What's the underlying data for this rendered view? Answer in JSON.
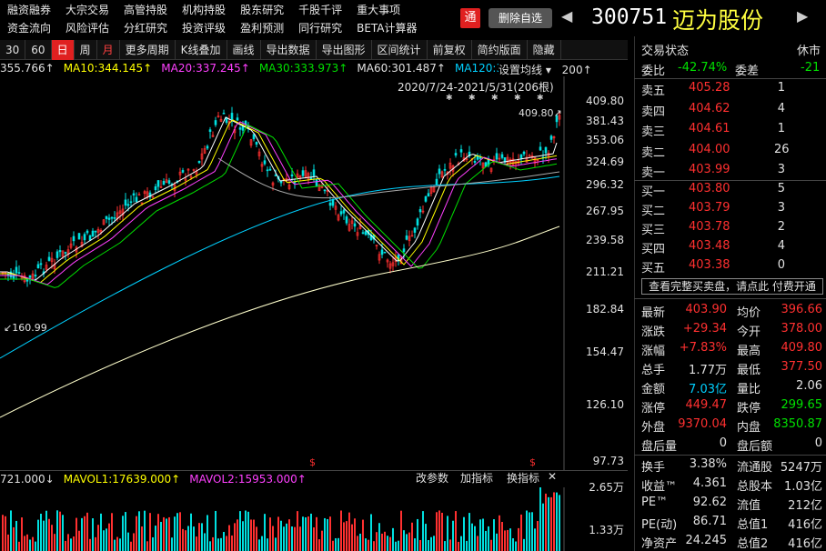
{
  "nav1": [
    "融资融券",
    "大宗交易",
    "高管持股",
    "机构持股",
    "股东研究",
    "千股千评",
    "重大事项"
  ],
  "nav2": [
    "资金流向",
    "风险评估",
    "分红研究",
    "投资评级",
    "盈利预测",
    "同行研究",
    "BETA计算器"
  ],
  "header": {
    "tong": "通",
    "remove": "删除自选",
    "left_arrow": "◀",
    "right_arrow": "▶",
    "code": "300751",
    "name": "迈为股份"
  },
  "toolbar": [
    "30",
    "60",
    "日",
    "周",
    "月",
    "更多周期",
    "K线叠加",
    "画线",
    "导出数据",
    "导出图形",
    "区间统计",
    "前复权",
    "简约版面",
    "隐藏"
  ],
  "ma": [
    {
      "label": "355.766↑",
      "color": "#e0e0e0"
    },
    {
      "label": "MA10:344.145↑",
      "color": "#ffff00"
    },
    {
      "label": "MA20:337.245↑",
      "color": "#ff40ff"
    },
    {
      "label": "MA30:333.973↑",
      "color": "#00e000"
    },
    {
      "label": "MA60:301.487↑",
      "color": "#e0e0e0"
    },
    {
      "label": "MA120:305.770",
      "color": "#00d0ff"
    }
  ],
  "ma_set": "设置均线",
  "ma_tail": "200↑",
  "daterange": "2020/7/24-2021/5/31(206根)",
  "yaxis": [
    "409.80",
    "381.43",
    "353.06",
    "324.69",
    "296.32",
    "267.95",
    "239.58",
    "211.21",
    "182.84",
    "154.47",
    "126.10",
    "97.73"
  ],
  "annot_high": "409.80↗",
  "annot_low": "↙160.99",
  "vol": {
    "head": [
      {
        "label": "721.000↓",
        "color": "#e0e0e0"
      },
      {
        "label": "MAVOL1:17639.000↑",
        "color": "#ffff00"
      },
      {
        "label": "MAVOL2:15953.000↑",
        "color": "#ff40ff"
      }
    ],
    "btns": [
      "改参数",
      "加指标",
      "换指标",
      "✕"
    ],
    "yaxis": [
      "2.65万",
      "1.33万"
    ]
  },
  "panel": {
    "title": "交易状态",
    "status": "休市",
    "weibi_label": "委比",
    "weibi": "-42.74%",
    "weicha_label": "委差",
    "weicha": "-21",
    "sells": [
      {
        "k": "卖五",
        "p": "405.28",
        "v": "1"
      },
      {
        "k": "卖四",
        "p": "404.62",
        "v": "4"
      },
      {
        "k": "卖三",
        "p": "404.61",
        "v": "1"
      },
      {
        "k": "卖二",
        "p": "404.00",
        "v": "26"
      },
      {
        "k": "卖一",
        "p": "403.99",
        "v": "3"
      }
    ],
    "buys": [
      {
        "k": "买一",
        "p": "403.80",
        "v": "5"
      },
      {
        "k": "买二",
        "p": "403.79",
        "v": "3"
      },
      {
        "k": "买三",
        "p": "403.78",
        "v": "2"
      },
      {
        "k": "买四",
        "p": "403.48",
        "v": "4"
      },
      {
        "k": "买五",
        "p": "403.38",
        "v": "0"
      }
    ],
    "banner": "查看完整买卖盘，请点此 付费开通",
    "stats": [
      {
        "k": "最新",
        "v": "403.90",
        "c": "red",
        "k2": "均价",
        "v2": "396.66",
        "c2": "red"
      },
      {
        "k": "涨跌",
        "v": "+29.34",
        "c": "red",
        "k2": "今开",
        "v2": "378.00",
        "c2": "red"
      },
      {
        "k": "涨幅",
        "v": "+7.83%",
        "c": "red",
        "k2": "最高",
        "v2": "409.80",
        "c2": "red"
      },
      {
        "k": "总手",
        "v": "1.77万",
        "c": "white",
        "k2": "最低",
        "v2": "377.50",
        "c2": "red"
      },
      {
        "k": "金额",
        "v": "7.03亿",
        "c": "cyan",
        "k2": "量比",
        "v2": "2.06",
        "c2": "white"
      },
      {
        "k": "涨停",
        "v": "449.47",
        "c": "red",
        "k2": "跌停",
        "v2": "299.65",
        "c2": "green"
      },
      {
        "k": "外盘",
        "v": "9370.04",
        "c": "red",
        "k2": "内盘",
        "v2": "8350.87",
        "c2": "green"
      },
      {
        "k": "盘后量",
        "v": "0",
        "c": "white",
        "k2": "盘后额",
        "v2": "0",
        "c2": "white"
      }
    ],
    "stats2": [
      {
        "k": "换手",
        "v": "3.38%",
        "k2": "流通股",
        "v2": "5247万"
      },
      {
        "k": "收益™",
        "v": "4.361",
        "k2": "总股本",
        "v2": "1.03亿"
      },
      {
        "k": "PE™",
        "v": "92.62",
        "k2": "流值",
        "v2": "212亿"
      },
      {
        "k": "PE(动)",
        "v": "86.71",
        "k2": "总值1",
        "v2": "416亿"
      },
      {
        "k": "净资产",
        "v": "24.245",
        "k2": "总值2",
        "v2": "416亿"
      }
    ]
  }
}
